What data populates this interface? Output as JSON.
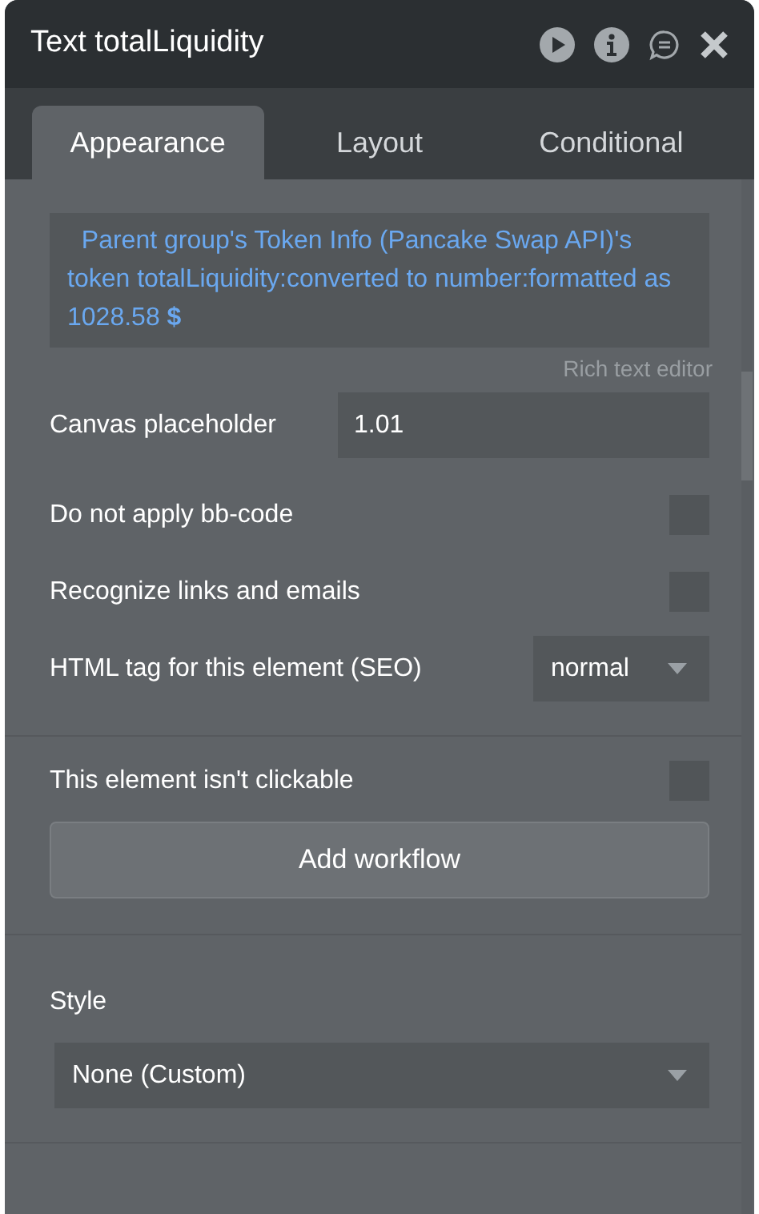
{
  "window": {
    "title": "Text totalLiquidity"
  },
  "tabs": [
    {
      "label": "Appearance",
      "selected": true
    },
    {
      "label": "Layout",
      "selected": false
    },
    {
      "label": "Conditional",
      "selected": false
    }
  ],
  "expression": {
    "text": "  Parent group's Token Info (Pancake Swap API)'s token totalLiquidity:converted to number:formatted as 1028.58 **$**",
    "link": "Rich text editor"
  },
  "canvas_placeholder": {
    "label": "Canvas placeholder",
    "value": "1.01"
  },
  "options": [
    {
      "label": "Do not apply bb-code",
      "checked": false
    },
    {
      "label": "Recognize links and emails",
      "checked": false
    }
  ],
  "html_tag": {
    "label": "HTML tag for this element (SEO)",
    "value": "normal"
  },
  "clickable": {
    "label": "This element isn't clickable",
    "checked": false
  },
  "add_workflow": "Add workflow",
  "style": {
    "label": "Style",
    "value": "None (Custom)"
  }
}
